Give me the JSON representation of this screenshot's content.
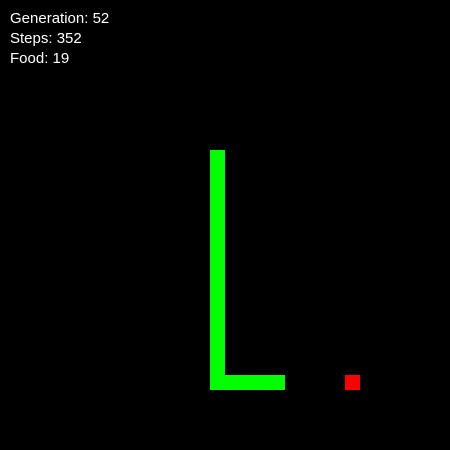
{
  "hud": {
    "generation_label": "Generation:",
    "generation": "52",
    "steps_label": "Steps:",
    "steps": "352",
    "food_label": "Food:",
    "food": "19"
  },
  "colors": {
    "background": "#000000",
    "snake": "#00ff00",
    "food": "#ff0000",
    "text": "#ffffff"
  }
}
